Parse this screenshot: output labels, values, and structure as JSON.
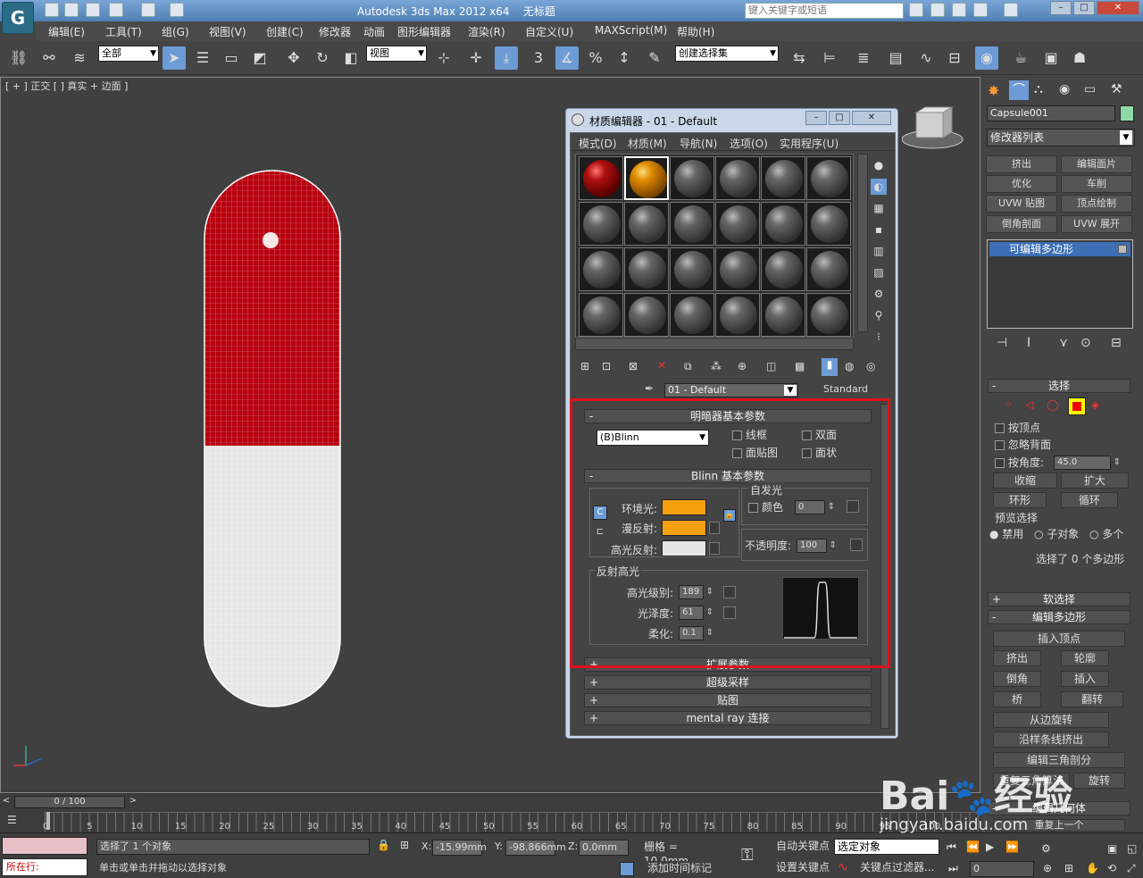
{
  "titlebar": {
    "app_title": "Autodesk 3ds Max  2012 x64",
    "doc_title": "无标题",
    "search_placeholder": "键入关键字或短语"
  },
  "menu": [
    "编辑(E)",
    "工具(T)",
    "组(G)",
    "视图(V)",
    "创建(C)",
    "修改器",
    "动画",
    "图形编辑器",
    "渲染(R)",
    "自定义(U)",
    "MAXScript(M)",
    "帮助(H)"
  ],
  "toolbar": {
    "selection_filter": "全部",
    "ref_coord": "视图",
    "named_selection": "创建选择集"
  },
  "viewport": {
    "label": "[ + ] 正交 [ ] 真实 + 边面 ]"
  },
  "material_editor": {
    "title": "材质编辑器 - 01 - Default",
    "menu": [
      "模式(D)",
      "材质(M)",
      "导航(N)",
      "选项(O)",
      "实用程序(U)"
    ],
    "material_name": "01 - Default",
    "material_type": "Standard",
    "shader_rollout": {
      "title": "明暗器基本参数",
      "shader": "(B)Blinn",
      "wire": "线框",
      "two_sided": "双面",
      "face_map": "面贴图",
      "faceted": "面状"
    },
    "blinn_rollout": {
      "title": "Blinn 基本参数",
      "self_illum_label": "自发光",
      "color_label": "颜色",
      "self_illum_value": "0",
      "ambient_label": "环境光:",
      "diffuse_label": "漫反射:",
      "specular_label": "高光反射:",
      "opacity_label": "不透明度:",
      "opacity_value": "100",
      "spec_highlights_label": "反射高光",
      "spec_level_label": "高光级别:",
      "spec_level": "189",
      "glossiness_label": "光泽度:",
      "glossiness": "61",
      "soften_label": "柔化:",
      "soften": "0.1"
    },
    "rollouts": [
      "扩展参数",
      "超级采样",
      "贴图",
      "mental ray 连接"
    ],
    "colors": {
      "ambient": "#f5a00f",
      "diffuse": "#f5a00f",
      "specular": "#e6e6e6"
    }
  },
  "command_panel": {
    "object_name": "Capsule001",
    "modifier_list": "修改器列表",
    "buttons": [
      "挤出",
      "编辑面片",
      "优化",
      "车削",
      "UVW 贴图",
      "顶点绘制",
      "倒角剖面",
      "UVW 展开"
    ],
    "stack_item": "可编辑多边形",
    "selection": {
      "title": "选择",
      "by_vertex": "按顶点",
      "ignore_backfacing": "忽略背面",
      "by_angle": "按角度:",
      "angle_value": "45.0",
      "shrink": "收缩",
      "grow": "扩大",
      "ring": "环形",
      "loop": "循环",
      "preview_label": "预览选择",
      "preview_options": [
        "禁用",
        "子对象",
        "多个"
      ],
      "status": "选择了 0 个多边形"
    },
    "soft_selection": "软选择",
    "edit_polygons": {
      "title": "编辑多边形",
      "insert_vertex": "插入顶点",
      "buttons": [
        "挤出",
        "轮廓",
        "倒角",
        "插入",
        "桥",
        "翻转"
      ],
      "hinge": "从边旋转",
      "extrude_spline": "沿样条线挤出",
      "edit_tri": "编辑三角剖分",
      "retri": "重复三角算法",
      "turn": "旋转"
    },
    "edit_geometry": "编辑几何体",
    "repeat_last": "重复上一个"
  },
  "timeline": {
    "frame": "0 / 100",
    "ticks": [
      "0",
      "5",
      "10",
      "15",
      "20",
      "25",
      "30",
      "35",
      "40",
      "45",
      "50",
      "55",
      "60",
      "65",
      "70",
      "75",
      "80",
      "85",
      "90",
      "95",
      "100"
    ]
  },
  "status": {
    "selected": "选择了 1 个对象",
    "hint": "单击或单击并拖动以选择对象",
    "running": "所在行:",
    "x": "-15.99mm",
    "y": "-98.866mm",
    "z": "0.0mm",
    "grid": "栅格 = 10.0mm",
    "add_time_tag": "添加时间标记",
    "auto_key": "自动关键点",
    "set_key": "设置关键点",
    "key_mode": "选定对象",
    "key_filters": "关键点过滤器...",
    "frame": "0"
  },
  "watermark": {
    "brand": "Bai",
    "brand2": "经验",
    "url": "jingyan.baidu.com"
  }
}
